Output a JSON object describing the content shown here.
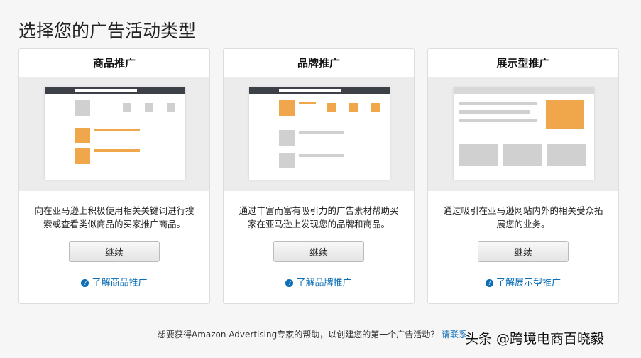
{
  "title": "选择您的广告活动类型",
  "cards": [
    {
      "name": "商品推广",
      "desc": "向在亚马逊上积极使用相关关键词进行搜索或查看类似商品的买家推广商品。",
      "button": "继续",
      "learn": "了解商品推广"
    },
    {
      "name": "品牌推广",
      "desc": "通过丰富而富有吸引力的广告素材帮助买家在亚马逊上发现您的品牌和商品。",
      "button": "继续",
      "learn": "了解品牌推广"
    },
    {
      "name": "展示型推广",
      "desc": "通过吸引在亚马逊网站内外的相关受众拓展您的业务。",
      "button": "继续",
      "learn": "了解展示型推广"
    }
  ],
  "footer": {
    "text": "想要获得Amazon Advertising专家的帮助，以创建您的第一个广告活动？",
    "link": "请联系"
  },
  "watermark": "头条 @跨境电商百晓毅",
  "accent": "#f0a64b"
}
